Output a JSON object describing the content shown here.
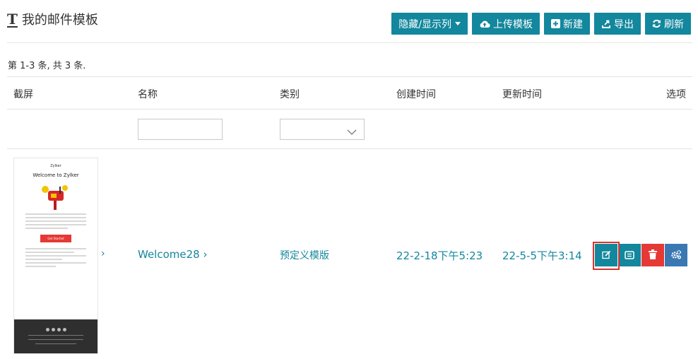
{
  "page": {
    "title": "我的邮件模板",
    "title_icon": "text-format-icon"
  },
  "toolbar": {
    "toggle_columns_label": "隐藏/显示列",
    "upload_label": "上传模板",
    "new_label": "新建",
    "export_label": "导出",
    "refresh_label": "刷新"
  },
  "summary": "第 1-3 条, 共 3 条.",
  "table": {
    "headers": [
      "截屏",
      "名称",
      "类别",
      "创建时间",
      "更新时间",
      "选项"
    ],
    "filters": {
      "name_value": "",
      "type_selected": ""
    },
    "rows": [
      {
        "thumbnail": {
          "brand": "Zylker",
          "heading": "Welcome to Zylker",
          "button": "Get Started"
        },
        "name": "Welcome28 ›",
        "type": "预定义模版",
        "created": "22-2-18下午5:23",
        "updated": "22-5-5下午3:14",
        "actions": [
          "edit-icon",
          "preview-icon",
          "trash-icon",
          "settings-icon"
        ]
      }
    ]
  },
  "colors": {
    "primary": "#13879d",
    "danger": "#e53935",
    "info": "#3a78b3",
    "highlight": "#d9342b"
  }
}
